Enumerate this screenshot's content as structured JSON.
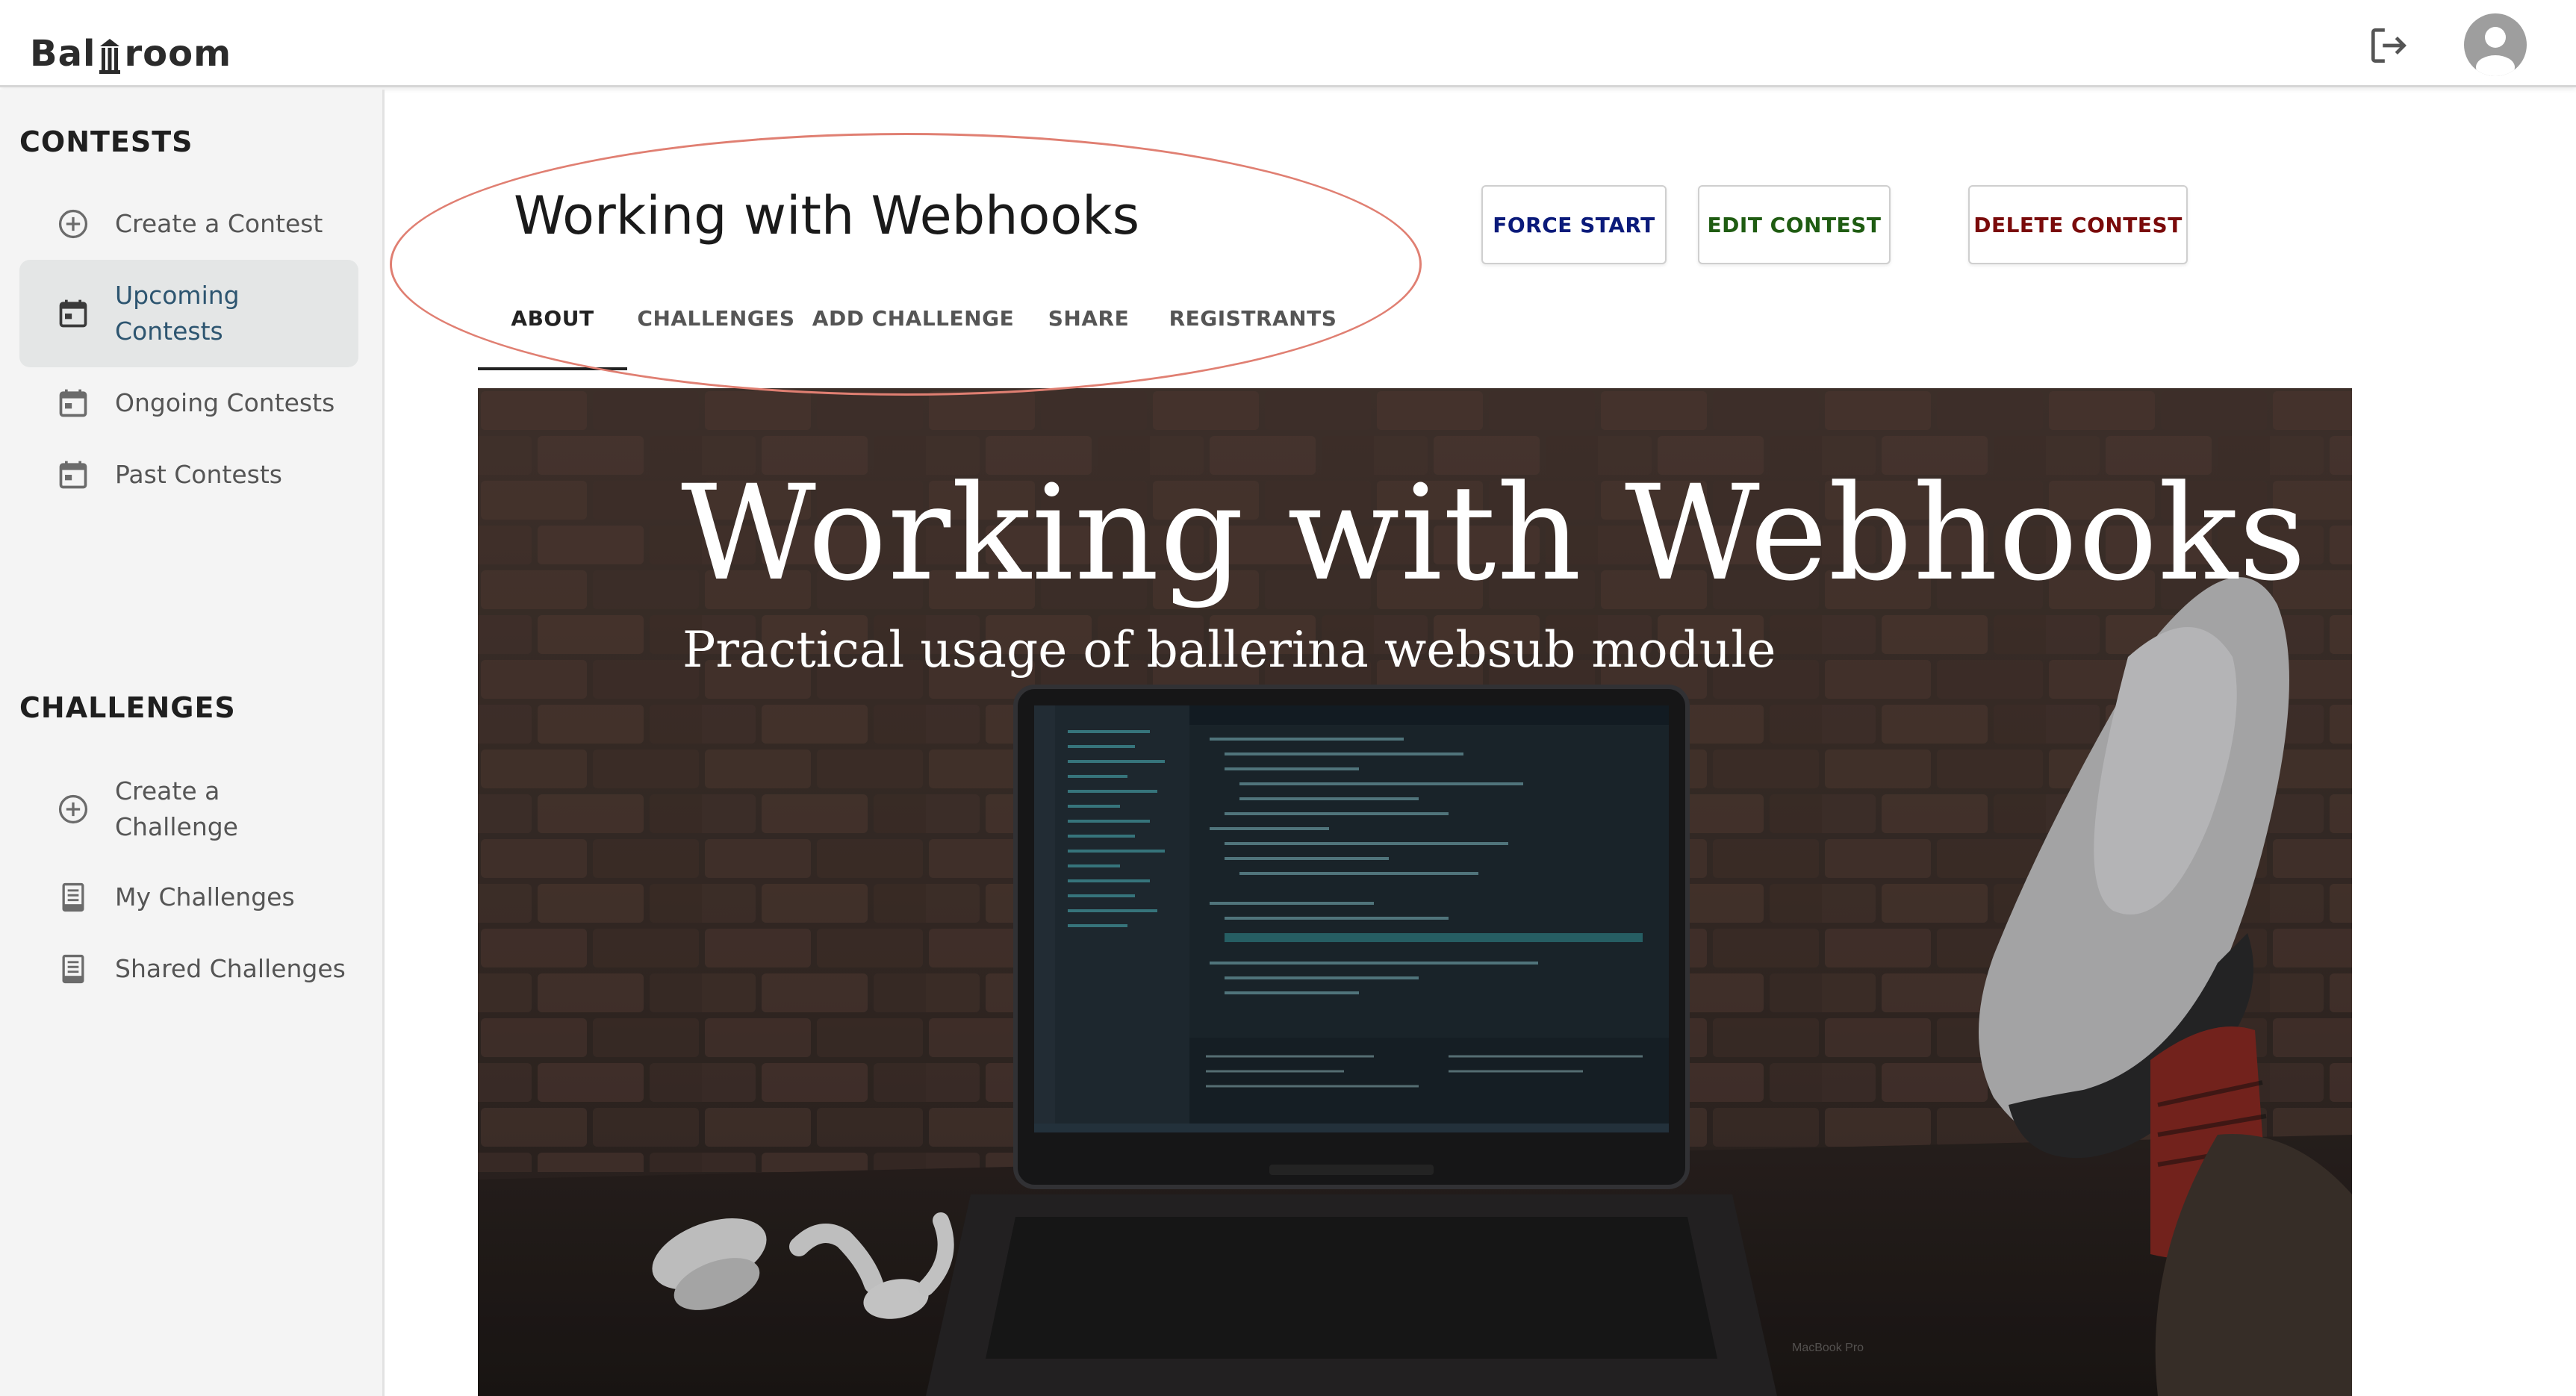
{
  "app": {
    "logo_text": "Ballroom",
    "colors": {
      "force_start": "#0a1a7a",
      "edit_contest": "#1f5c12",
      "delete_contest": "#7a0a0a",
      "annotation_ellipse": "#e07f72",
      "sidebar_active_label": "#2d5570"
    }
  },
  "header": {
    "logout_icon": "logout-icon",
    "avatar_icon": "account-circle-icon"
  },
  "sidebar": {
    "contests_title": "CONTESTS",
    "contests_items": [
      {
        "label": "Create a Contest",
        "icon": "add-circle-icon"
      },
      {
        "label": "Upcoming Contests",
        "icon": "calendar-icon",
        "active": true
      },
      {
        "label": "Ongoing Contests",
        "icon": "calendar-icon"
      },
      {
        "label": "Past Contests",
        "icon": "calendar-icon"
      }
    ],
    "challenges_title": "CHALLENGES",
    "challenges_items": [
      {
        "label": "Create a Challenge",
        "icon": "add-circle-icon"
      },
      {
        "label": "My Challenges",
        "icon": "document-icon"
      },
      {
        "label": "Shared Challenges",
        "icon": "document-icon"
      }
    ]
  },
  "contest": {
    "title": "Working with Webhooks",
    "tabs": [
      {
        "label": "ABOUT",
        "active": true
      },
      {
        "label": "CHALLENGES"
      },
      {
        "label": "ADD CHALLENGE"
      },
      {
        "label": "SHARE"
      },
      {
        "label": "REGISTRANTS"
      }
    ],
    "buttons": {
      "force_start": "FORCE START",
      "edit_contest": "EDIT CONTEST",
      "delete_contest": "DELETE CONTEST"
    }
  },
  "banner": {
    "headline": "Working with Webhooks",
    "subheadline": "Practical usage of ballerina websub module",
    "laptop_label": "MacBook Pro"
  }
}
